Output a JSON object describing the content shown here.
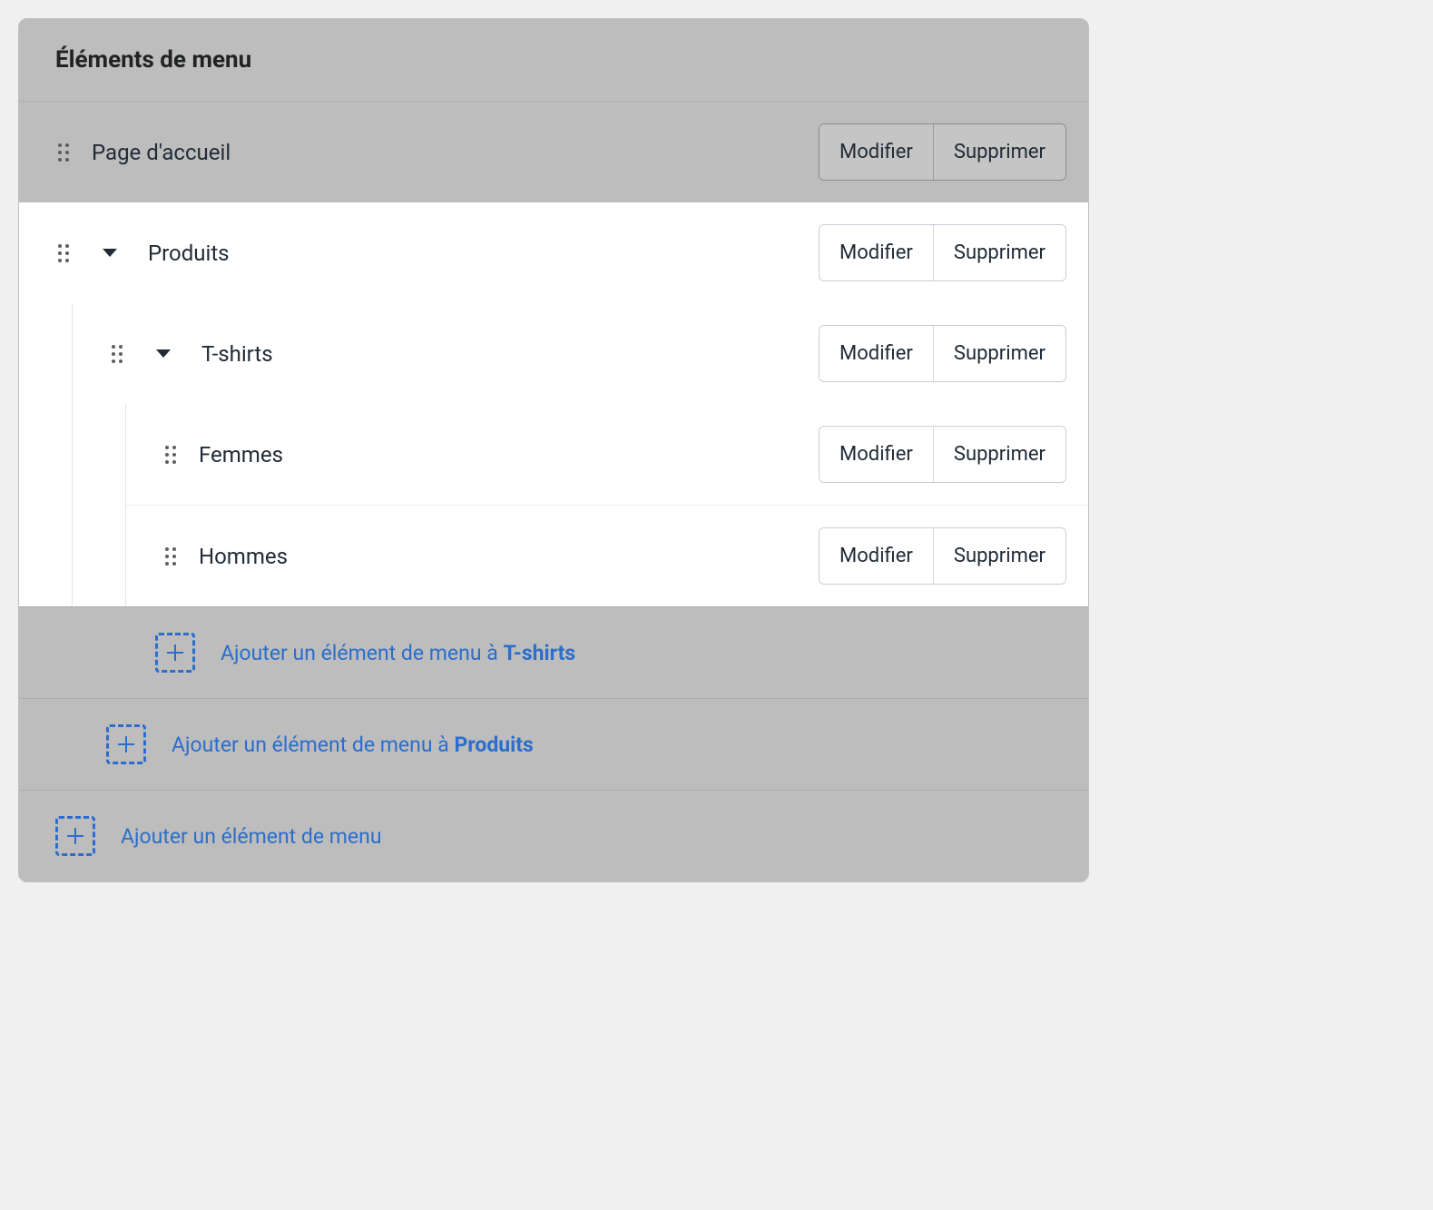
{
  "header": {
    "title": "Éléments de menu"
  },
  "actions": {
    "edit": "Modifier",
    "delete": "Supprimer"
  },
  "items": {
    "home": {
      "label": "Page d'accueil"
    },
    "products": {
      "label": "Produits"
    },
    "tshirts": {
      "label": "T-shirts"
    },
    "women": {
      "label": "Femmes"
    },
    "men": {
      "label": "Hommes"
    }
  },
  "add": {
    "prefix": "Ajouter un élément de menu à ",
    "to_tshirts_target": "T-shirts",
    "to_products_target": "Produits",
    "root": "Ajouter un élément de menu"
  },
  "colors": {
    "accent": "#2c6ecb",
    "text": "#212B36"
  }
}
